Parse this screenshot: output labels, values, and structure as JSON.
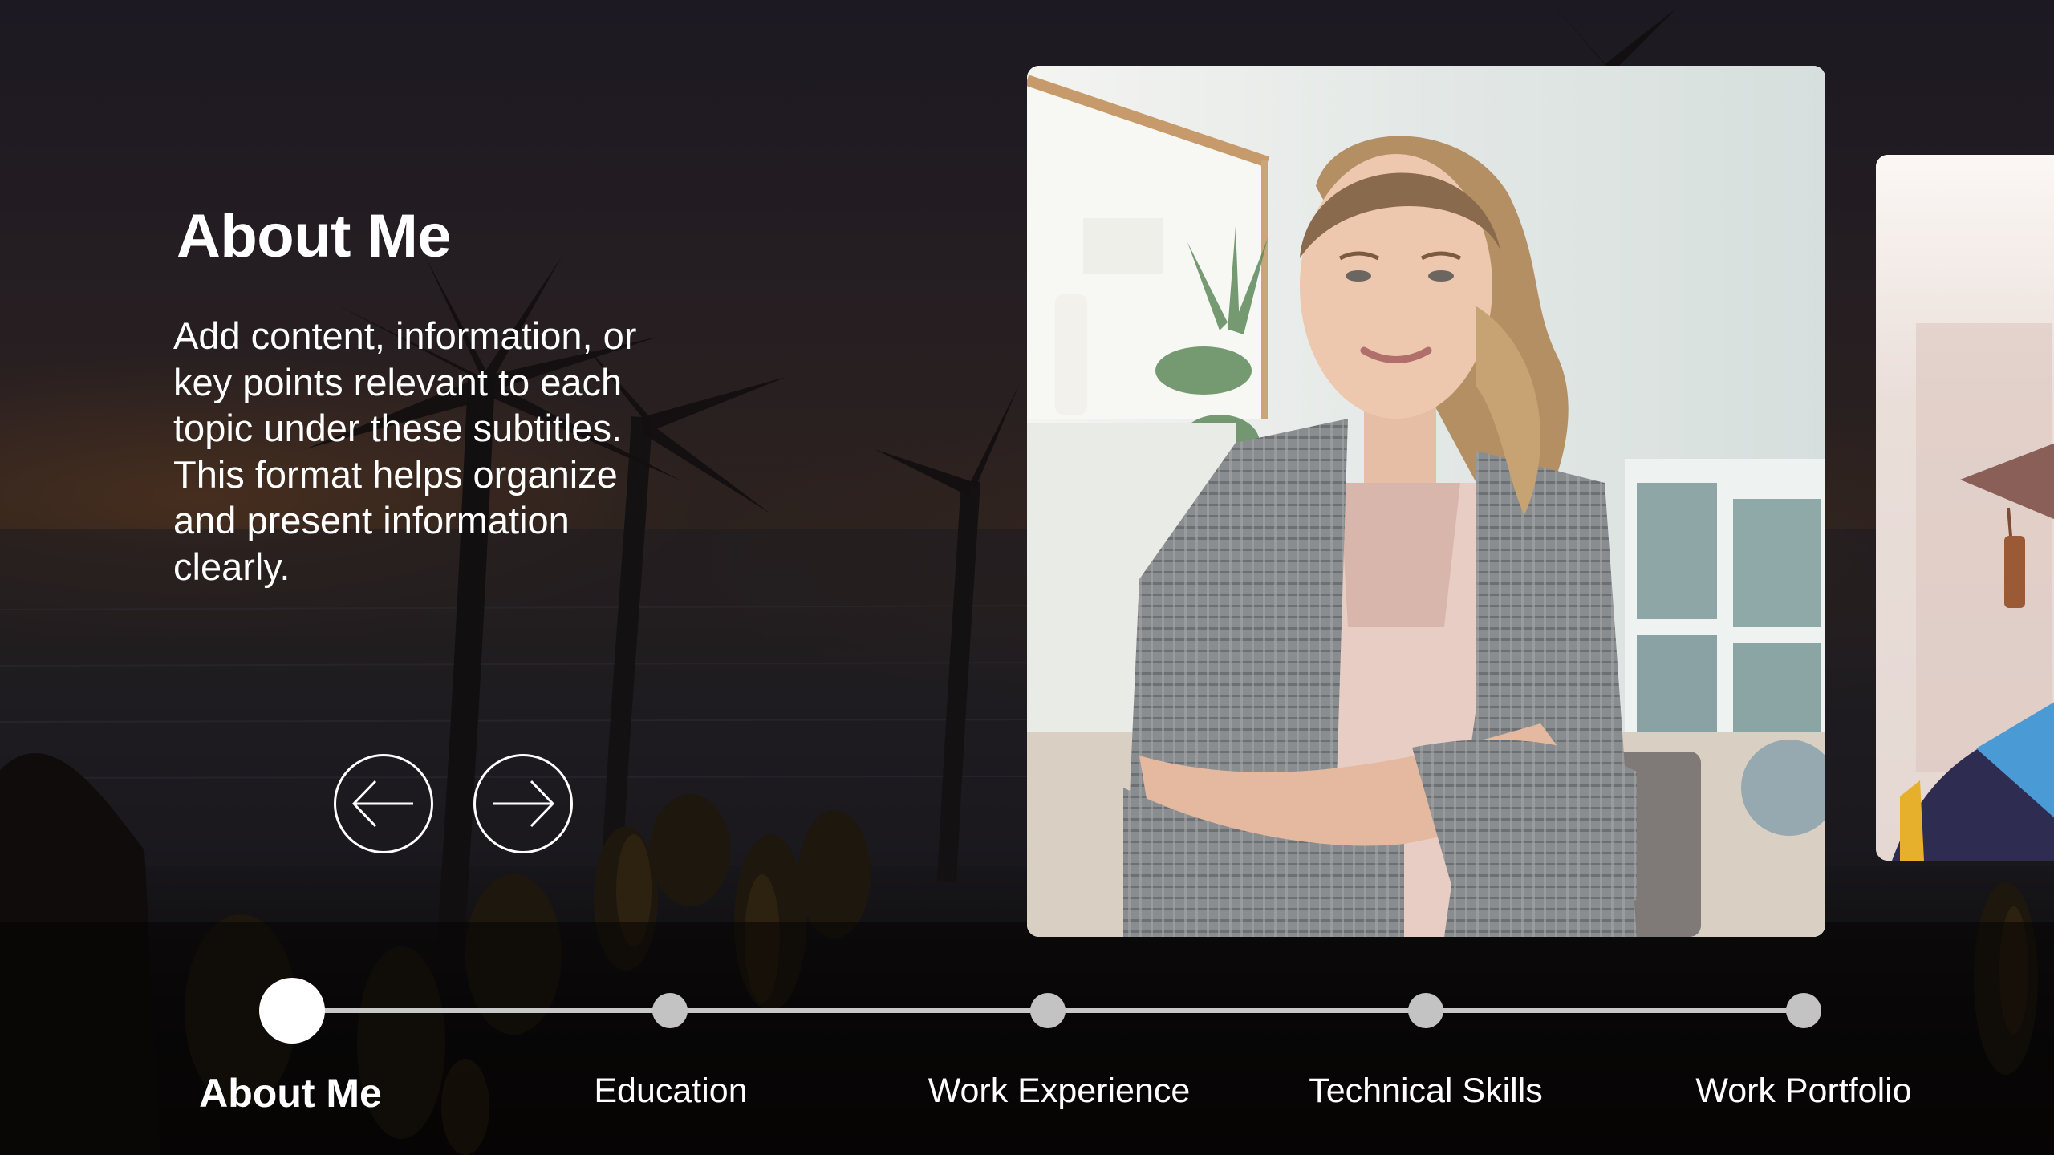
{
  "section": {
    "title": "About Me",
    "body_lines": [
      "Add content, information, or",
      "key points relevant to each",
      "topic under these subtitles.",
      "This format helps organize",
      "and present information",
      "clearly."
    ]
  },
  "navigation": {
    "prev_icon": "arrow-left-icon",
    "next_icon": "arrow-right-icon"
  },
  "cards": [
    {
      "name": "portrait-photo",
      "description": "Woman in plaid blazer with arms crossed in a bright office"
    },
    {
      "name": "graduation-photo",
      "description": "Graduate wearing cap with tassel and blue stole (partially visible)"
    }
  ],
  "timeline": {
    "active_index": 0,
    "steps": [
      {
        "label": "About Me"
      },
      {
        "label": "Education"
      },
      {
        "label": "Work Experience"
      },
      {
        "label": "Technical Skills"
      },
      {
        "label": "Work Portfolio"
      }
    ]
  },
  "colors": {
    "text": "#ffffff",
    "timeline_line": "#c9c8c8",
    "timeline_dot": "#c4c3c3",
    "timeline_dot_active": "#ffffff",
    "background_top": "#1c1922",
    "background_bottom": "#070605"
  }
}
